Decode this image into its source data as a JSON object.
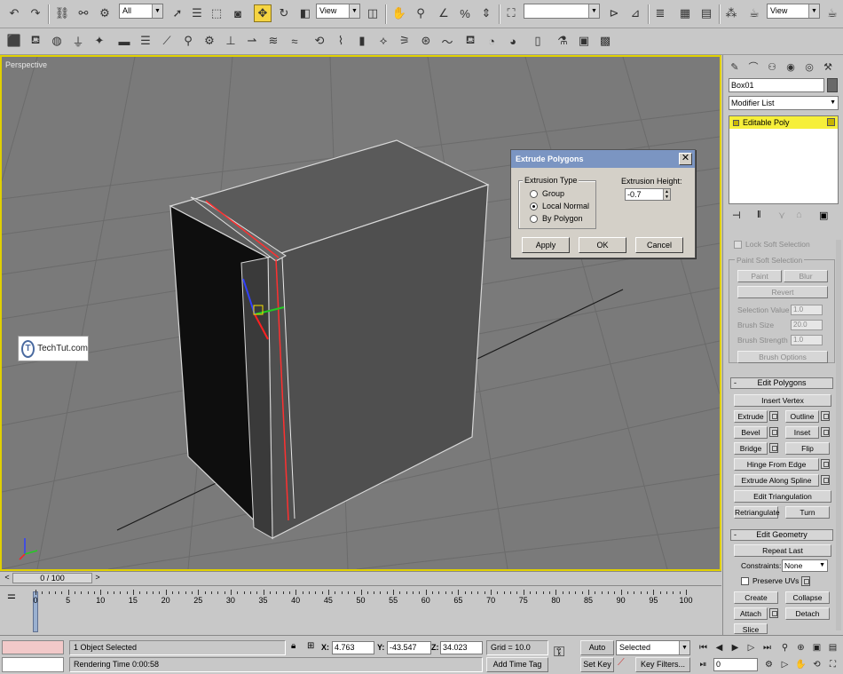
{
  "toolbar_main": {
    "selection_filter": "All",
    "ref_coord": "View",
    "named_sel": "",
    "view_combo": "View",
    "icons": [
      "undo-icon",
      "redo-icon",
      "select-link-icon",
      "unlink-icon",
      "bind-spacewarp-icon",
      "select-object-icon",
      "select-by-name-icon",
      "rect-region-icon",
      "window-crossing-icon",
      "select-move-icon",
      "select-rotate-icon",
      "select-scale-icon",
      "pivot-icon",
      "mirror-icon",
      "align-icon",
      "snap-icon",
      "angle-snap-icon",
      "percent-snap-icon",
      "spinner-snap-icon",
      "named-selection-icon",
      "mirror-axis-icon",
      "layer-manager-icon",
      "curve-editor-icon",
      "schematic-icon",
      "material-editor-icon",
      "render-scene-icon",
      "quick-render-icon"
    ]
  },
  "toolbar_extras": {
    "icons": [
      "create-box-icon",
      "create-sphere-icon",
      "create-teapot-icon",
      "create-plane-icon",
      "create-star-icon",
      "lights-icon",
      "cameras-icon",
      "helpers-icon",
      "spacewarps-icon",
      "systems-icon",
      "modifier-bend-icon",
      "modifier-taper-icon",
      "modifier-twist-icon",
      "modifier-noise-icon",
      "modifier-wave-icon",
      "modifier-ripple-icon",
      "modifier-lattice-icon",
      "modifier-ffd-icon",
      "modifier-skin-icon",
      "modifier-unwrap-icon",
      "modifier-mesh-smooth-icon",
      "modifier-uvw-icon",
      "modifier-edit-poly-icon",
      "modifier-extrude-icon",
      "modifier-lathe-icon",
      "render-setup-icon",
      "environment-icon",
      "effects-icon",
      "video-post-icon"
    ]
  },
  "viewport": {
    "label": "Perspective"
  },
  "dialog": {
    "title": "Extrude Polygons",
    "extrusion_type_label": "Extrusion Type",
    "options": [
      "Group",
      "Local Normal",
      "By Polygon"
    ],
    "selected_option": "Local Normal",
    "height_label": "Extrusion Height:",
    "height_value": "-0.7",
    "apply_label": "Apply",
    "ok_label": "OK",
    "cancel_label": "Cancel",
    "close_symbol": "✕"
  },
  "watermark": {
    "logo_letter": "T",
    "text": "TechTut.com"
  },
  "command_panel": {
    "object_name": "Box01",
    "modifier_list": "Modifier List",
    "stack_item": "Editable Poly",
    "soft_selection": {
      "lock_label": "Lock Soft Selection",
      "paint_group": "Paint Soft Selection",
      "paint": "Paint",
      "blur": "Blur",
      "revert": "Revert",
      "selection_value_label": "Selection Value",
      "selection_value": "1.0",
      "brush_size_label": "Brush Size",
      "brush_size": "20.0",
      "brush_strength_label": "Brush Strength",
      "brush_strength": "1.0",
      "brush_options": "Brush Options"
    },
    "edit_polygons": {
      "header": "Edit Polygons",
      "sign": "-",
      "insert_vertex": "Insert Vertex",
      "extrude": "Extrude",
      "outline": "Outline",
      "bevel": "Bevel",
      "inset": "Inset",
      "bridge": "Bridge",
      "flip": "Flip",
      "hinge_from_edge": "Hinge From Edge",
      "extrude_along_spline": "Extrude Along Spline",
      "edit_triangulation": "Edit Triangulation",
      "retriangulate": "Retriangulate",
      "turn": "Turn"
    },
    "edit_geometry": {
      "header": "Edit Geometry",
      "sign": "-",
      "repeat_last": "Repeat Last",
      "constraints_label": "Constraints:",
      "constraints_value": "None",
      "preserve_uvs": "Preserve UVs",
      "create": "Create",
      "collapse": "Collapse",
      "attach": "Attach",
      "detach": "Detach",
      "slice_plane": "Slice Plane"
    }
  },
  "timeslider": {
    "frame_label": "0 / 100",
    "prev": "<",
    "next": ">"
  },
  "track": {
    "ticks": [
      "0",
      "5",
      "10",
      "15",
      "20",
      "25",
      "30",
      "35",
      "40",
      "45",
      "50",
      "55",
      "60",
      "65",
      "70",
      "75",
      "80",
      "85",
      "90",
      "95",
      "100"
    ]
  },
  "status": {
    "selection": "1 Object Selected",
    "prompt": "Rendering Time  0:00:58",
    "x_label": "X:",
    "x_value": "4.763",
    "y_label": "Y:",
    "y_value": "-43.547",
    "z_label": "Z:",
    "z_value": "34.023",
    "grid": "Grid = 10.0",
    "add_time_tag": "Add Time Tag",
    "auto_key": "Auto Key",
    "set_key": "Set Key",
    "key_mode": "Selected",
    "key_filters": "Key Filters...",
    "frame": "0"
  },
  "colors": {
    "viewport_bg": "#7a7a7a",
    "active_border": "#e0d000",
    "dialog_title": "#7b95c2",
    "stack_highlight": "#f6ef3a",
    "selection_red": "#ff3030"
  }
}
